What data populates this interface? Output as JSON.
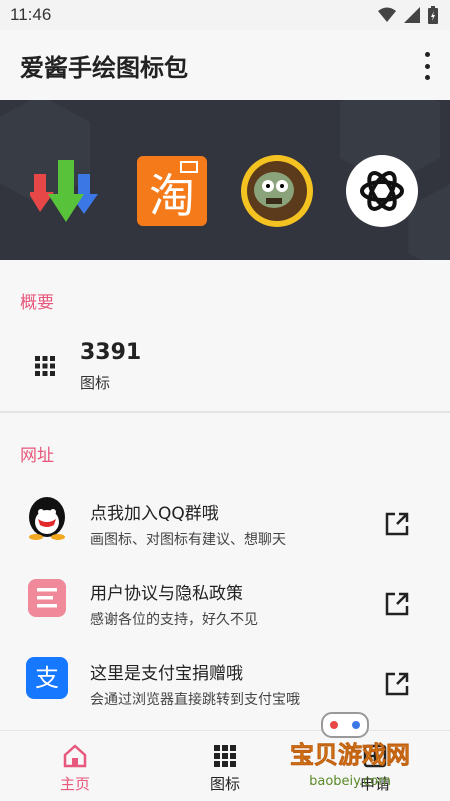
{
  "status_bar": {
    "time": "11:46",
    "icons": [
      "wifi-icon",
      "signal-icon",
      "battery-icon"
    ]
  },
  "app_bar": {
    "title": "爱酱手绘图标包",
    "menu_icon": "more-vert-icon"
  },
  "banner": {
    "icons": [
      "download-arrows-icon",
      "taobao-icon",
      "zombie-icon",
      "openai-icon"
    ]
  },
  "overview": {
    "title": "概要",
    "count": "3391",
    "count_label": "图标"
  },
  "links": {
    "title": "网址",
    "items": [
      {
        "primary": "点我加入QQ群哦",
        "secondary": "画图标、对图标有建议、想聊天",
        "icon": "qq-icon"
      },
      {
        "primary": "用户协议与隐私政策",
        "secondary": "感谢各位的支持，好久不见",
        "icon": "document-icon"
      },
      {
        "primary": "这里是支付宝捐赠哦",
        "secondary": "会通过浏览器直接跳转到支付宝哦",
        "icon": "alipay-icon"
      }
    ]
  },
  "bottom_nav": {
    "items": [
      {
        "label": "主页",
        "icon": "home-icon",
        "active": true
      },
      {
        "label": "图标",
        "icon": "grid-icon",
        "active": false
      },
      {
        "label": "申请",
        "icon": "request-icon",
        "active": false
      }
    ]
  },
  "watermark": {
    "brand": "宝贝游戏网",
    "url": "baobeiy.com"
  },
  "colors": {
    "accent": "#e8577c",
    "banner_bg": "#32353d",
    "text": "#222222"
  }
}
